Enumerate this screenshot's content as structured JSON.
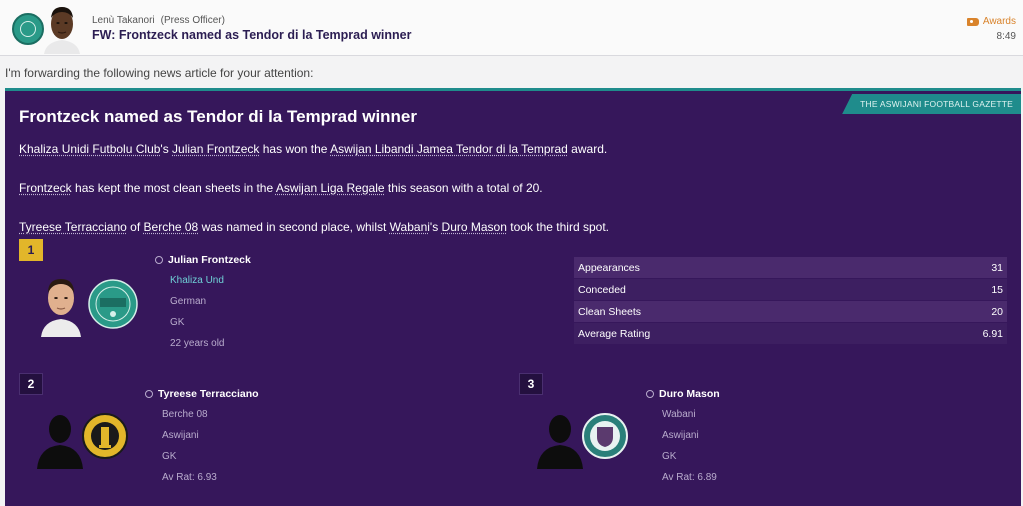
{
  "header": {
    "sender_name": "Lenù Takanori",
    "sender_role": "(Press Officer)",
    "subject": "FW: Frontzeck named as Tendor di la Temprad winner",
    "tag_label": "Awards",
    "time": "8:49",
    "icons": {
      "tag": "tag-icon",
      "club": "club-badge-icon"
    }
  },
  "intro": "I'm forwarding the following news article for your attention:",
  "article": {
    "source": "THE ASWIJANI FOOTBALL GAZETTE",
    "headline": "Frontzeck named as Tendor di la Temprad winner",
    "p1": {
      "club": "Khaliza Unidi Futbolu Club",
      "t1": "'s ",
      "player": "Julian Frontzeck",
      "t2": " has won the ",
      "award": "Aswijan Libandi Jamea Tendor di la Temprad",
      "t3": " award."
    },
    "p2": {
      "player": "Frontzeck",
      "t1": " has kept the most clean sheets in the ",
      "league": "Aswijan Liga Regale",
      "t2": " this season with a total of 20."
    },
    "p3": {
      "player2": "Tyreese Terracciano",
      "t1": " of ",
      "club2": "Berche 08",
      "t2": " was named in second place, whilst ",
      "club3": "Wabani",
      "t3": "'s ",
      "player3": "Duro Mason",
      "t4": " took the third spot."
    }
  },
  "winners": [
    {
      "rank": "1",
      "name": "Julian Frontzeck",
      "club": "Khaliza Und",
      "nationality": "German",
      "position": "GK",
      "age": "22 years old"
    },
    {
      "rank": "2",
      "name": "Tyreese Terracciano",
      "club": "Berche 08",
      "nationality": "Aswijani",
      "position": "GK",
      "rating": "Av Rat: 6.93"
    },
    {
      "rank": "3",
      "name": "Duro Mason",
      "club": "Wabani",
      "nationality": "Aswijani",
      "position": "GK",
      "rating": "Av Rat: 6.89"
    }
  ],
  "stats": [
    {
      "label": "Appearances",
      "value": "31"
    },
    {
      "label": "Conceded",
      "value": "15"
    },
    {
      "label": "Clean Sheets",
      "value": "20"
    },
    {
      "label": "Average Rating",
      "value": "6.91"
    }
  ],
  "colors": {
    "panel": "#36175b",
    "accent": "#1f8c8c",
    "gold": "#e2b62a",
    "link": "#6fd0d6"
  }
}
